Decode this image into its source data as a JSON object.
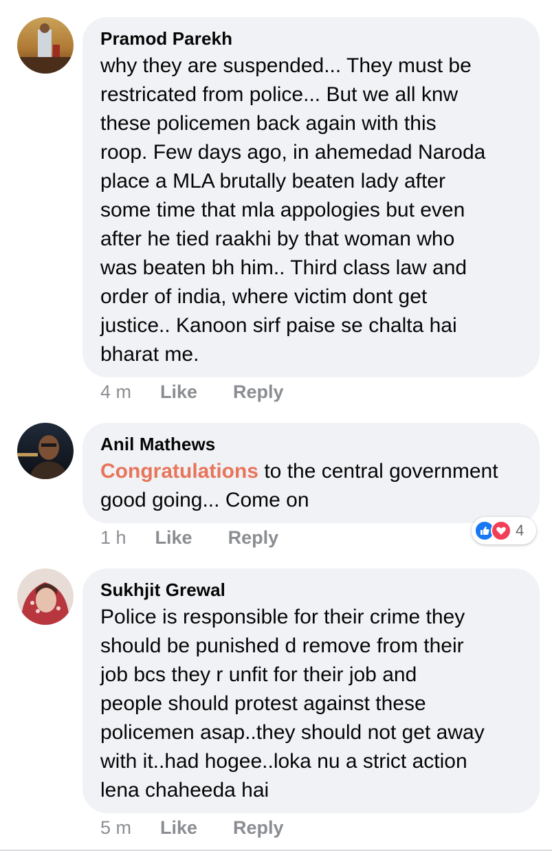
{
  "comments": [
    {
      "author": "Pramod Parekh",
      "text": "why they are suspended... They must be\nrestricated from police... But we all knw\nthese policemen back again with this\nroop. Few days ago, in ahemedad Naroda\nplace a MLA brutally beaten lady after\nsome time that mla appologies but even\nafter he tied raakhi by that woman who\nwas beaten bh him.. Third class law and\norder of india, where victim dont get\njustice.. Kanoon sirf paise se chalta hai\nbharat me.",
      "time": "4 m",
      "like_label": "Like",
      "reply_label": "Reply"
    },
    {
      "author": "Anil Mathews",
      "mention": "Congratulations",
      "text_after_mention": " to the central government\ngood going... Come on",
      "time": "1 h",
      "like_label": "Like",
      "reply_label": "Reply",
      "reactions": {
        "types": [
          "like",
          "love"
        ],
        "count": "4"
      }
    },
    {
      "author": "Sukhjit Grewal",
      "text": "Police is responsible for their crime they\nshould be punished d remove  from their\njob bcs they r unfit for their job and\npeople should protest against these\npolicemen asap..they should not get away\nwith it..had hogee..loka nu a strict action\nlena  chaheeda hai",
      "time": "5 m",
      "like_label": "Like",
      "reply_label": "Reply"
    }
  ],
  "colors": {
    "bubble": "#f0f2f5",
    "mention": "#e8745a",
    "meta": "#8a8d91",
    "like_reaction": "#1877f2",
    "love_reaction": "#f33e58"
  }
}
